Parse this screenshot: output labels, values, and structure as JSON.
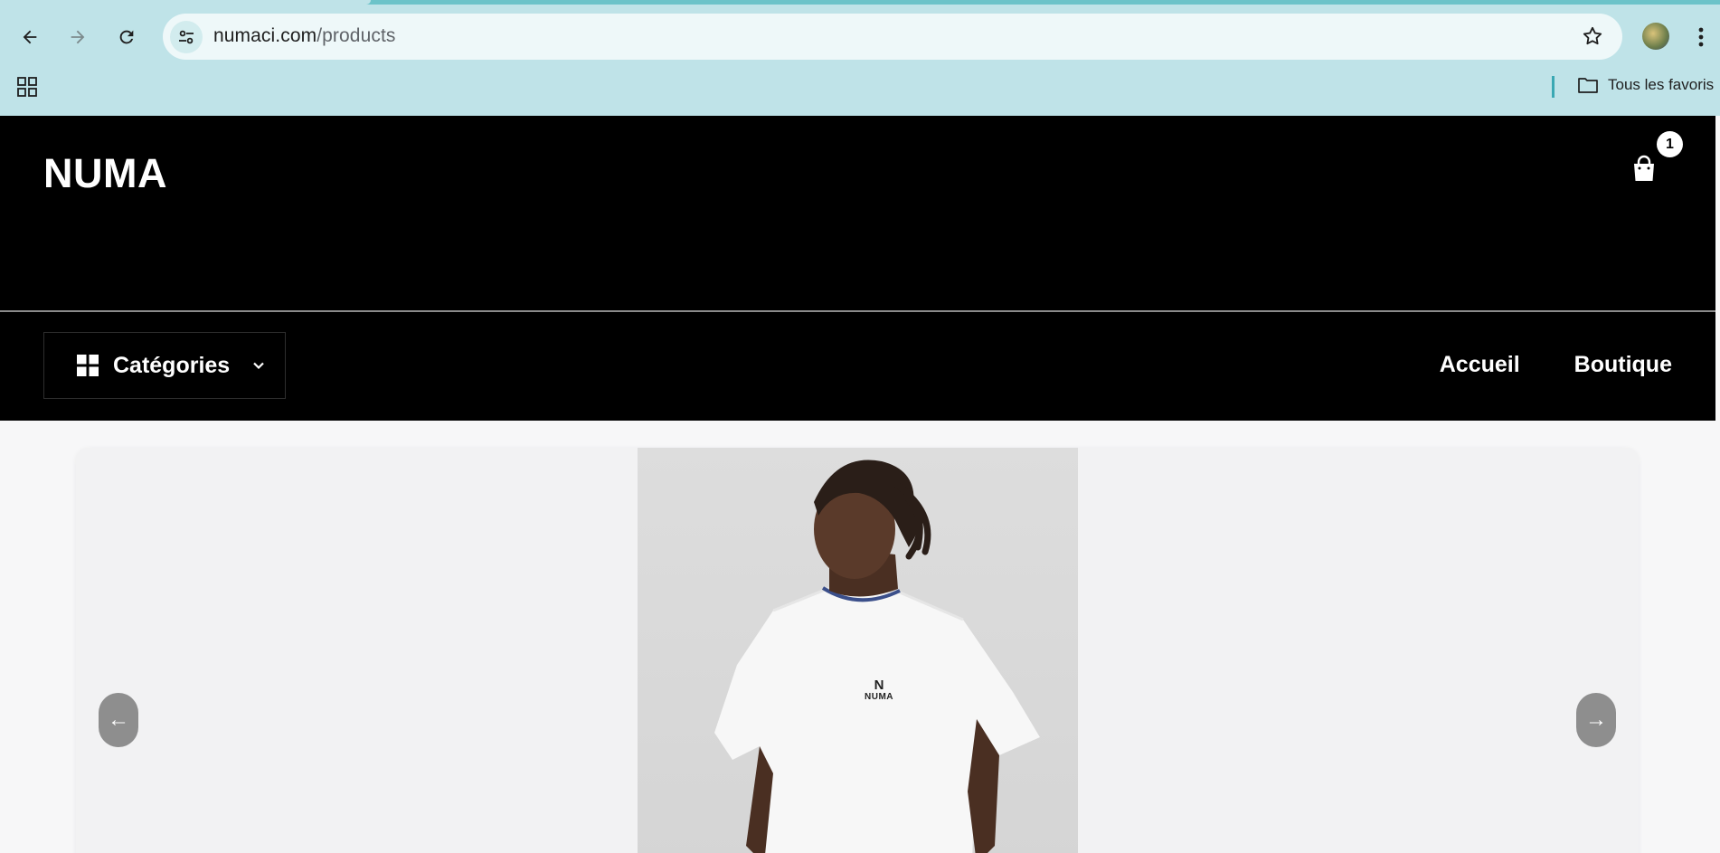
{
  "browser": {
    "url_host": "numaci.com",
    "url_path": "/products",
    "bookmarks_folder": "Tous les favoris"
  },
  "site": {
    "logo": "NUMA",
    "cart_count": "1",
    "categories_label": "Catégories",
    "nav": [
      {
        "label": "Accueil"
      },
      {
        "label": "Boutique"
      }
    ]
  },
  "carousel": {
    "prev_label": "←",
    "next_label": "→",
    "shirt_brand": "NUMA",
    "shirt_monogram": "N"
  },
  "colors": {
    "chrome_bg": "#bfe3e8",
    "header_bg": "#000000",
    "page_bg": "#f7f7f8",
    "arrow_bg": "#8e8e8e"
  }
}
